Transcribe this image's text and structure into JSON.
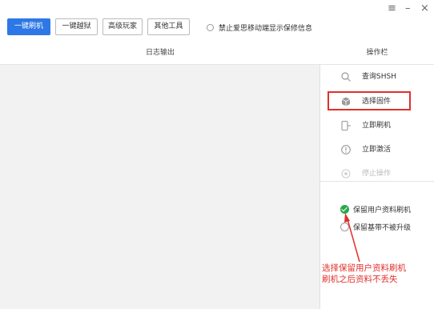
{
  "toolbar": {
    "tabs": [
      {
        "label": "一键刷机",
        "active": true
      },
      {
        "label": "一键越狱",
        "active": false
      },
      {
        "label": "高级玩家",
        "active": false
      },
      {
        "label": "其他工具",
        "active": false
      }
    ],
    "option_label": "禁止爱思移动端显示保修信息"
  },
  "window_controls": {
    "menu": "≡",
    "minimize": "–",
    "close": "×"
  },
  "header": {
    "log_title": "日志输出",
    "panel_title": "操作栏"
  },
  "operations": [
    {
      "label": "查询SHSH",
      "icon": "search-icon"
    },
    {
      "label": "选择固件",
      "icon": "cube-icon"
    },
    {
      "label": "立即刷机",
      "icon": "device-arrow-icon"
    },
    {
      "label": "立即激活",
      "icon": "alert-circle-icon"
    },
    {
      "label": "停止操作",
      "icon": "stop-icon",
      "disabled": true
    }
  ],
  "flash_options": [
    {
      "label": "保留用户资料刷机",
      "checked": true
    },
    {
      "label": "保留基带不被升级",
      "checked": false
    }
  ],
  "annotation": {
    "line1": "选择保留用户资料刷机",
    "line2": "刷机之后资料不丢失",
    "color": "#e0302b"
  },
  "colors": {
    "accent": "#2d78e6",
    "check": "#2aa84a",
    "highlight": "#e0302b"
  }
}
